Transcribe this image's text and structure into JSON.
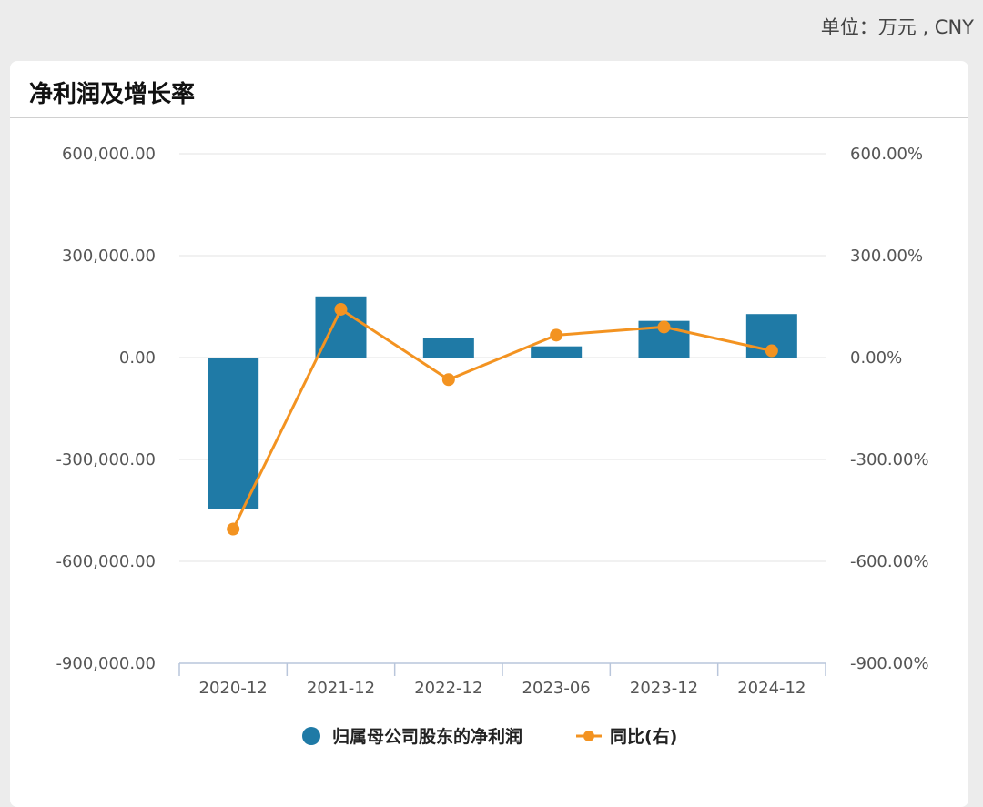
{
  "unit_label": "单位：万元 , CNY",
  "card": {
    "title": "净利润及增长率"
  },
  "chart_data": {
    "type": "bar",
    "categories": [
      "2020-12",
      "2021-12",
      "2022-12",
      "2023-06",
      "2023-12",
      "2024-12"
    ],
    "series": [
      {
        "name": "归属母公司股东的净利润",
        "type": "bar",
        "axis": "left",
        "color": "#1f7aa6",
        "values": [
          -445000,
          180000,
          57000,
          33000,
          108000,
          128000
        ]
      },
      {
        "name": "同比(右)",
        "type": "line",
        "axis": "right",
        "color": "#f39321",
        "values": [
          -505,
          142,
          -65,
          66,
          90,
          20
        ]
      }
    ],
    "y_left": {
      "ticks": [
        "600,000.00",
        "300,000.00",
        "0.00",
        "-300,000.00",
        "-600,000.00",
        "-900,000.00"
      ],
      "ylim": [
        -900000,
        600000
      ]
    },
    "y_right": {
      "ticks": [
        "600.00%",
        "300.00%",
        "0.00%",
        "-300.00%",
        "-600.00%",
        "-900.00%"
      ],
      "ylim": [
        -900,
        600
      ]
    },
    "grid": true,
    "legend": "bottom"
  }
}
